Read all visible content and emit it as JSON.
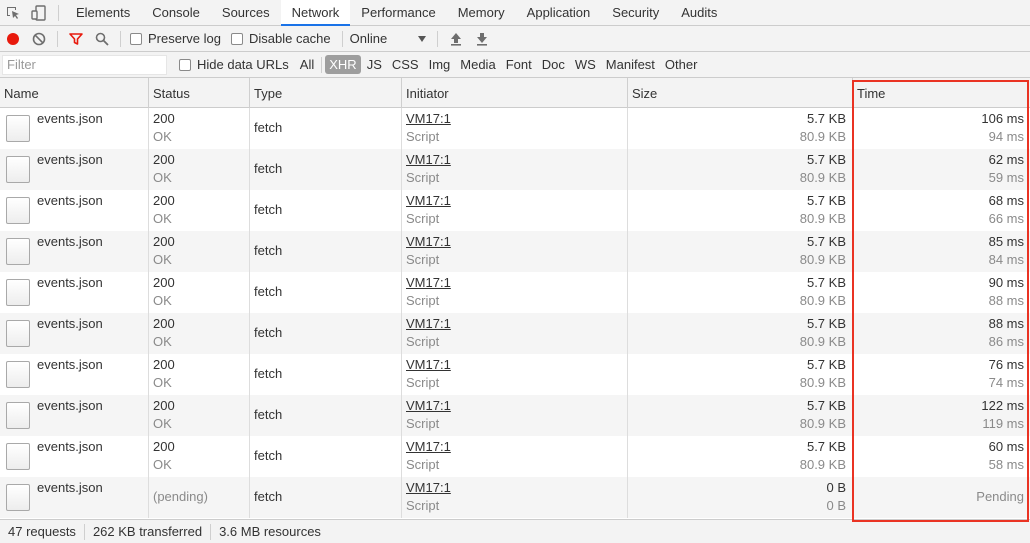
{
  "tabs": [
    "Elements",
    "Console",
    "Sources",
    "Network",
    "Performance",
    "Memory",
    "Application",
    "Security",
    "Audits"
  ],
  "active_tab": "Network",
  "toolbar": {
    "preserve_log_label": "Preserve log",
    "disable_cache_label": "Disable cache",
    "throttle_value": "Online"
  },
  "filterbar": {
    "filter_placeholder": "Filter",
    "hide_data_urls_label": "Hide data URLs",
    "types": [
      "All",
      "XHR",
      "JS",
      "CSS",
      "Img",
      "Media",
      "Font",
      "Doc",
      "WS",
      "Manifest",
      "Other"
    ],
    "active_type": "XHR"
  },
  "columns": {
    "name": "Name",
    "status": "Status",
    "type": "Type",
    "initiator": "Initiator",
    "size": "Size",
    "time": "Time"
  },
  "rows": [
    {
      "name": "events.json",
      "status": "200",
      "status_text": "OK",
      "type": "fetch",
      "initiator": "VM17:1",
      "initiator_type": "Script",
      "size": "5.7 KB",
      "resource_size": "80.9 KB",
      "time": "106 ms",
      "latency": "94 ms"
    },
    {
      "name": "events.json",
      "status": "200",
      "status_text": "OK",
      "type": "fetch",
      "initiator": "VM17:1",
      "initiator_type": "Script",
      "size": "5.7 KB",
      "resource_size": "80.9 KB",
      "time": "62 ms",
      "latency": "59 ms"
    },
    {
      "name": "events.json",
      "status": "200",
      "status_text": "OK",
      "type": "fetch",
      "initiator": "VM17:1",
      "initiator_type": "Script",
      "size": "5.7 KB",
      "resource_size": "80.9 KB",
      "time": "68 ms",
      "latency": "66 ms"
    },
    {
      "name": "events.json",
      "status": "200",
      "status_text": "OK",
      "type": "fetch",
      "initiator": "VM17:1",
      "initiator_type": "Script",
      "size": "5.7 KB",
      "resource_size": "80.9 KB",
      "time": "85 ms",
      "latency": "84 ms"
    },
    {
      "name": "events.json",
      "status": "200",
      "status_text": "OK",
      "type": "fetch",
      "initiator": "VM17:1",
      "initiator_type": "Script",
      "size": "5.7 KB",
      "resource_size": "80.9 KB",
      "time": "90 ms",
      "latency": "88 ms"
    },
    {
      "name": "events.json",
      "status": "200",
      "status_text": "OK",
      "type": "fetch",
      "initiator": "VM17:1",
      "initiator_type": "Script",
      "size": "5.7 KB",
      "resource_size": "80.9 KB",
      "time": "88 ms",
      "latency": "86 ms"
    },
    {
      "name": "events.json",
      "status": "200",
      "status_text": "OK",
      "type": "fetch",
      "initiator": "VM17:1",
      "initiator_type": "Script",
      "size": "5.7 KB",
      "resource_size": "80.9 KB",
      "time": "76 ms",
      "latency": "74 ms"
    },
    {
      "name": "events.json",
      "status": "200",
      "status_text": "OK",
      "type": "fetch",
      "initiator": "VM17:1",
      "initiator_type": "Script",
      "size": "5.7 KB",
      "resource_size": "80.9 KB",
      "time": "122 ms",
      "latency": "119 ms"
    },
    {
      "name": "events.json",
      "status": "200",
      "status_text": "OK",
      "type": "fetch",
      "initiator": "VM17:1",
      "initiator_type": "Script",
      "size": "5.7 KB",
      "resource_size": "80.9 KB",
      "time": "60 ms",
      "latency": "58 ms"
    },
    {
      "name": "events.json",
      "status": "(pending)",
      "status_text": "",
      "type": "fetch",
      "initiator": "VM17:1",
      "initiator_type": "Script",
      "size": "0 B",
      "resource_size": "0 B",
      "time": "Pending",
      "latency": ""
    }
  ],
  "statusbar": {
    "requests": "47 requests",
    "transferred": "262 KB transferred",
    "resources": "3.6 MB resources"
  },
  "colors": {
    "accent": "#1a73e8",
    "record": "#e8190c",
    "filter_icon": "#e8190c",
    "highlight": "#ea3323"
  }
}
